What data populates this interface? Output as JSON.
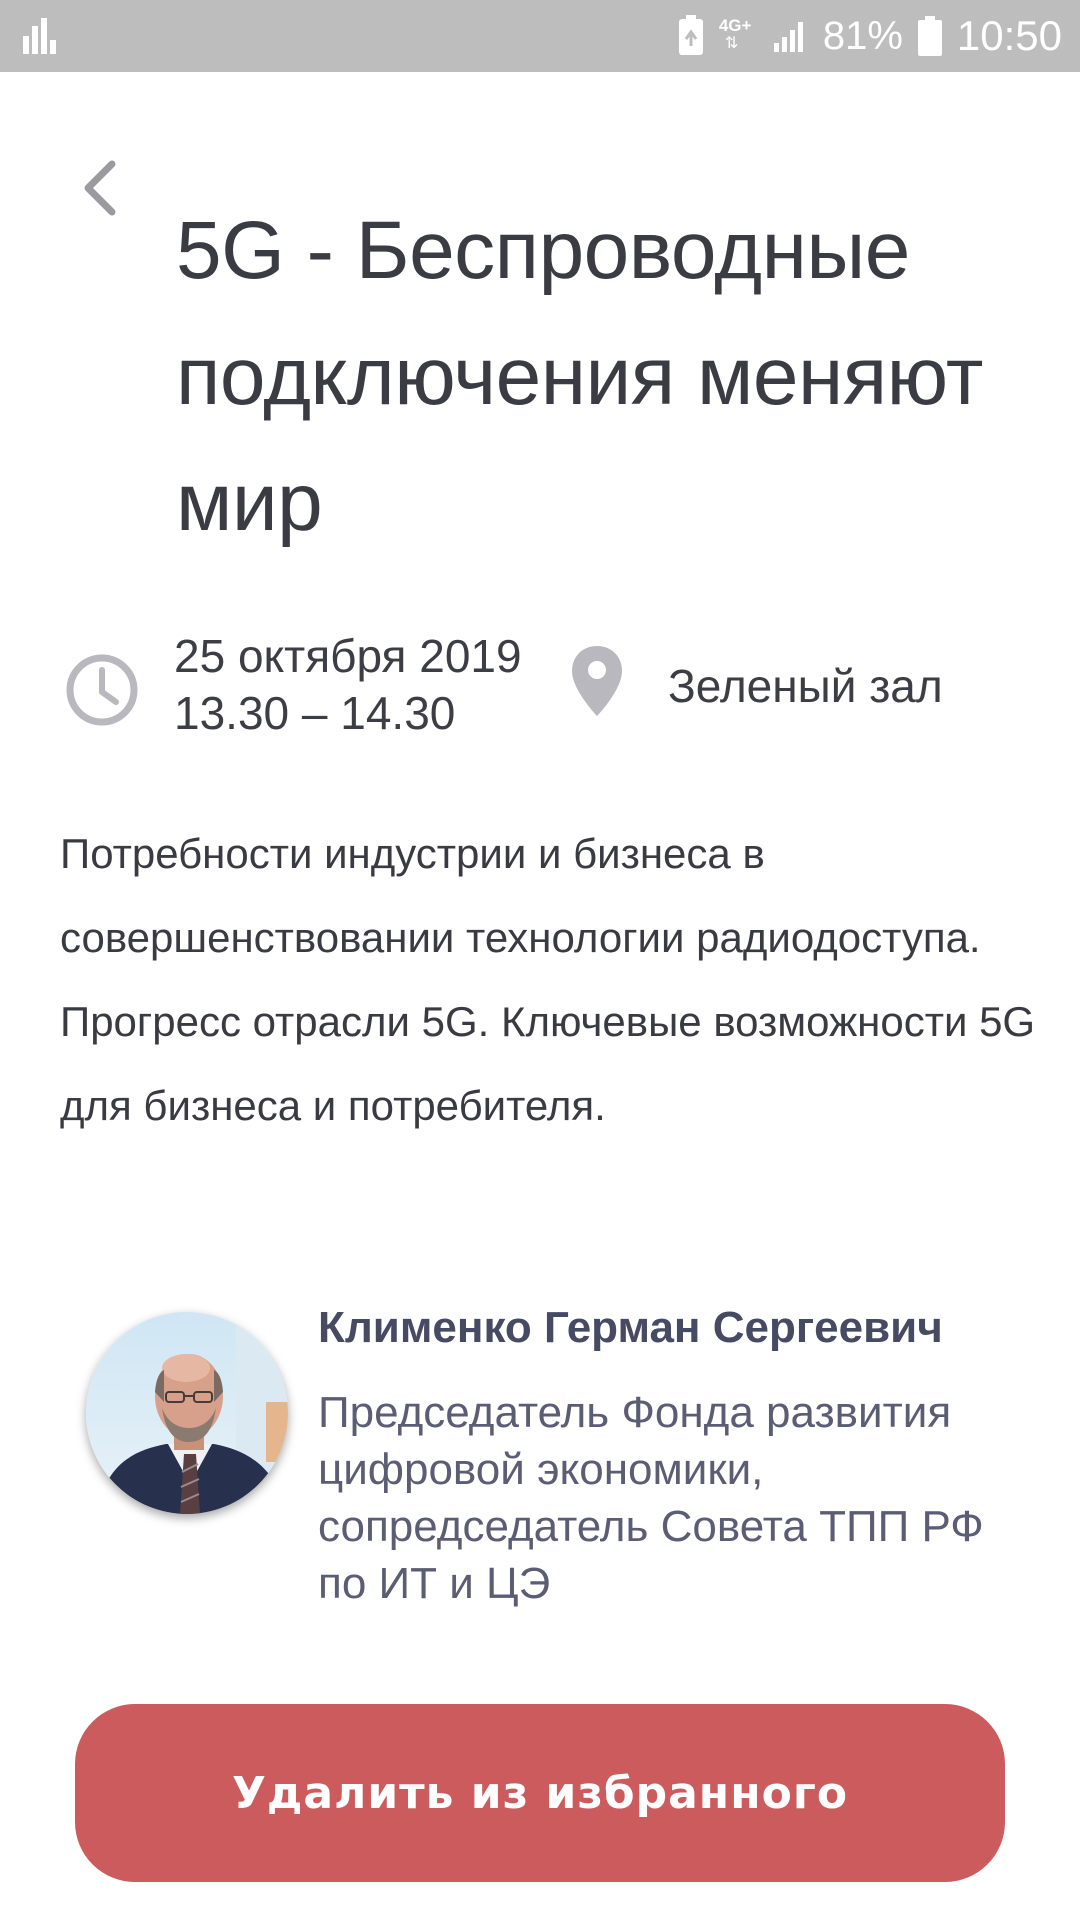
{
  "status_bar": {
    "network": "4G+",
    "battery_percent": "81%",
    "time": "10:50"
  },
  "header": {
    "back_icon": "chevron-left-icon",
    "title": "5G - Беспроводные подключения меняют мир"
  },
  "session": {
    "date": "25 октября 2019",
    "time_range": "13.30 – 14.30",
    "place": "Зеленый зал"
  },
  "description": "Потребности индустрии и бизнеса в совершенствовании технологии радиодоступа. Прогресс отрасли 5G. Ключевые возможности 5G для бизнеса и потребителя.",
  "speaker": {
    "name": "Клименко Герман Сергеевич",
    "role": "Председатель Фонда развития цифровой экономики, сопредседатель Совета ТПП РФ по ИТ и ЦЭ"
  },
  "actions": {
    "remove_label": "Удалить из избранного"
  },
  "colors": {
    "status_bar_bg": "#bdbdbd",
    "title_text": "#3b3b43",
    "icon_gray": "#b8b8be",
    "speaker_name": "#474a63",
    "button_bg": "#cc5b5e",
    "button_text": "#ffffff"
  }
}
